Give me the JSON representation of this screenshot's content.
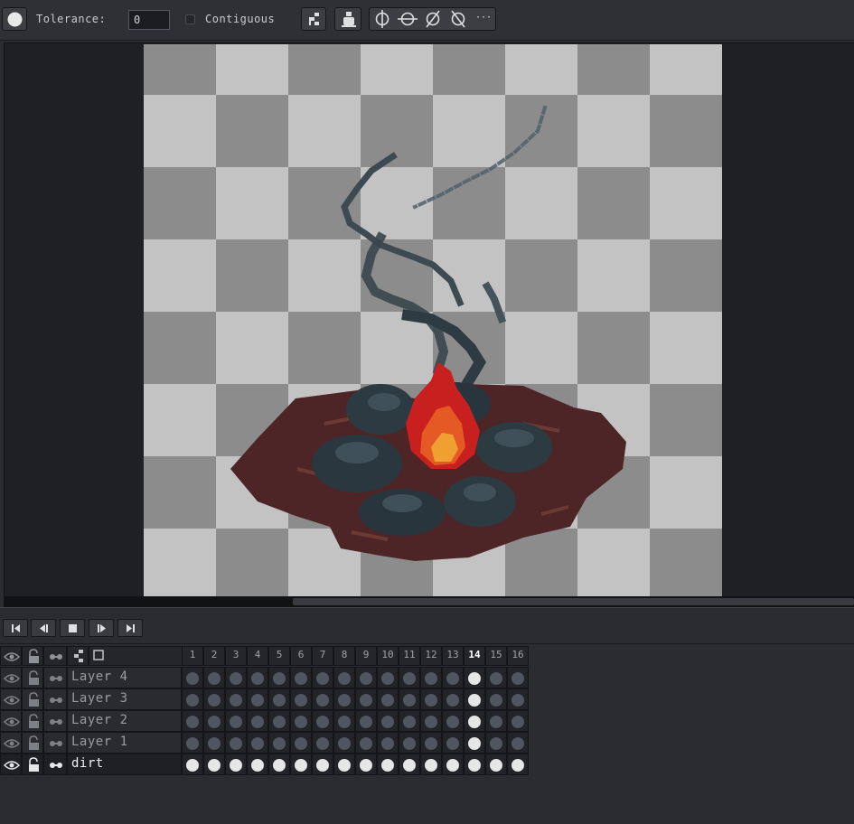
{
  "toolbar": {
    "tolerance_label": "Tolerance:",
    "tolerance_value": "0",
    "contiguous_label": "Contiguous",
    "more_label": "···"
  },
  "timeline": {
    "frames": [
      "1",
      "2",
      "3",
      "4",
      "5",
      "6",
      "7",
      "8",
      "9",
      "10",
      "11",
      "12",
      "13",
      "14",
      "15",
      "16"
    ],
    "current_frame": "14",
    "layers": [
      {
        "name": "Layer 4",
        "selected": false,
        "cels": [
          0,
          0,
          0,
          0,
          0,
          0,
          0,
          0,
          0,
          0,
          0,
          0,
          0,
          1,
          0,
          0
        ]
      },
      {
        "name": "Layer 3",
        "selected": false,
        "cels": [
          0,
          0,
          0,
          0,
          0,
          0,
          0,
          0,
          0,
          0,
          0,
          0,
          0,
          1,
          0,
          0
        ]
      },
      {
        "name": "Layer 2",
        "selected": false,
        "cels": [
          0,
          0,
          0,
          0,
          0,
          0,
          0,
          0,
          0,
          0,
          0,
          0,
          0,
          1,
          0,
          0
        ]
      },
      {
        "name": "Layer 1",
        "selected": false,
        "cels": [
          0,
          0,
          0,
          0,
          0,
          0,
          0,
          0,
          0,
          0,
          0,
          0,
          0,
          1,
          0,
          0
        ]
      },
      {
        "name": "dirt",
        "selected": true,
        "cels": [
          1,
          1,
          1,
          1,
          1,
          1,
          1,
          1,
          1,
          1,
          1,
          1,
          1,
          1,
          1,
          1
        ]
      }
    ]
  },
  "colors": {
    "checker_light": "#c3c3c3",
    "checker_dark": "#8c8c8c",
    "dirt": "#4e2527",
    "rock": "#2c3a42",
    "smoke": "#3a4a52",
    "fire_outer": "#c8201e",
    "fire_inner": "#f0a030"
  }
}
